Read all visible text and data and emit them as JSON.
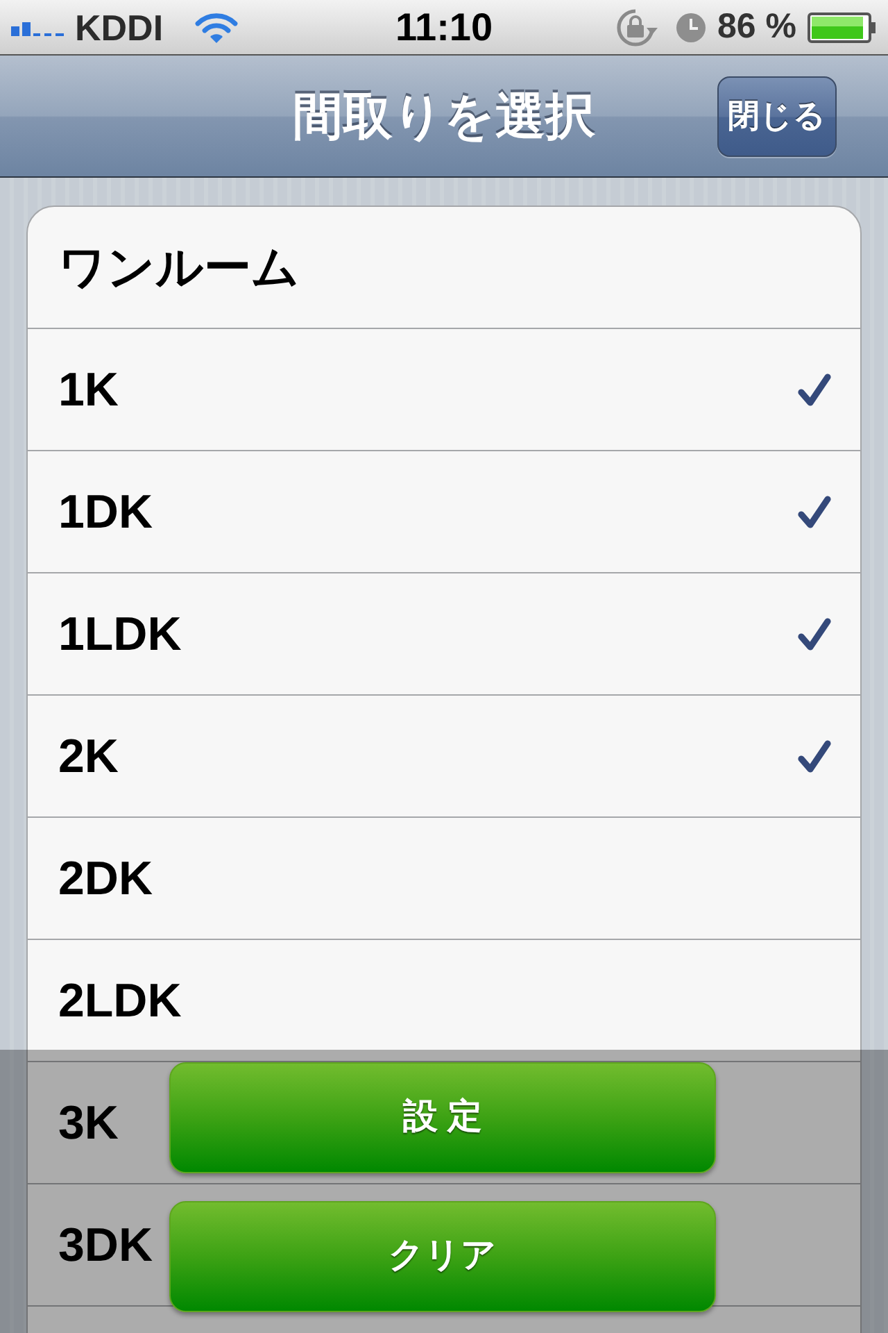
{
  "status_bar": {
    "carrier": "KDDI",
    "time": "11:10",
    "battery_text": "86 %"
  },
  "nav_bar": {
    "title": "間取りを選択",
    "close_button": "閉じる"
  },
  "rows": [
    {
      "label": "ワンルーム",
      "checked": false
    },
    {
      "label": "1K",
      "checked": true
    },
    {
      "label": "1DK",
      "checked": true
    },
    {
      "label": "1LDK",
      "checked": true
    },
    {
      "label": "2K",
      "checked": true
    },
    {
      "label": "2DK",
      "checked": false
    },
    {
      "label": "2LDK",
      "checked": false
    },
    {
      "label": "3K",
      "checked": false
    },
    {
      "label": "3DK",
      "checked": false
    }
  ],
  "overlay": {
    "buttons": [
      {
        "label": "設 定"
      },
      {
        "label": "クリア"
      }
    ]
  }
}
